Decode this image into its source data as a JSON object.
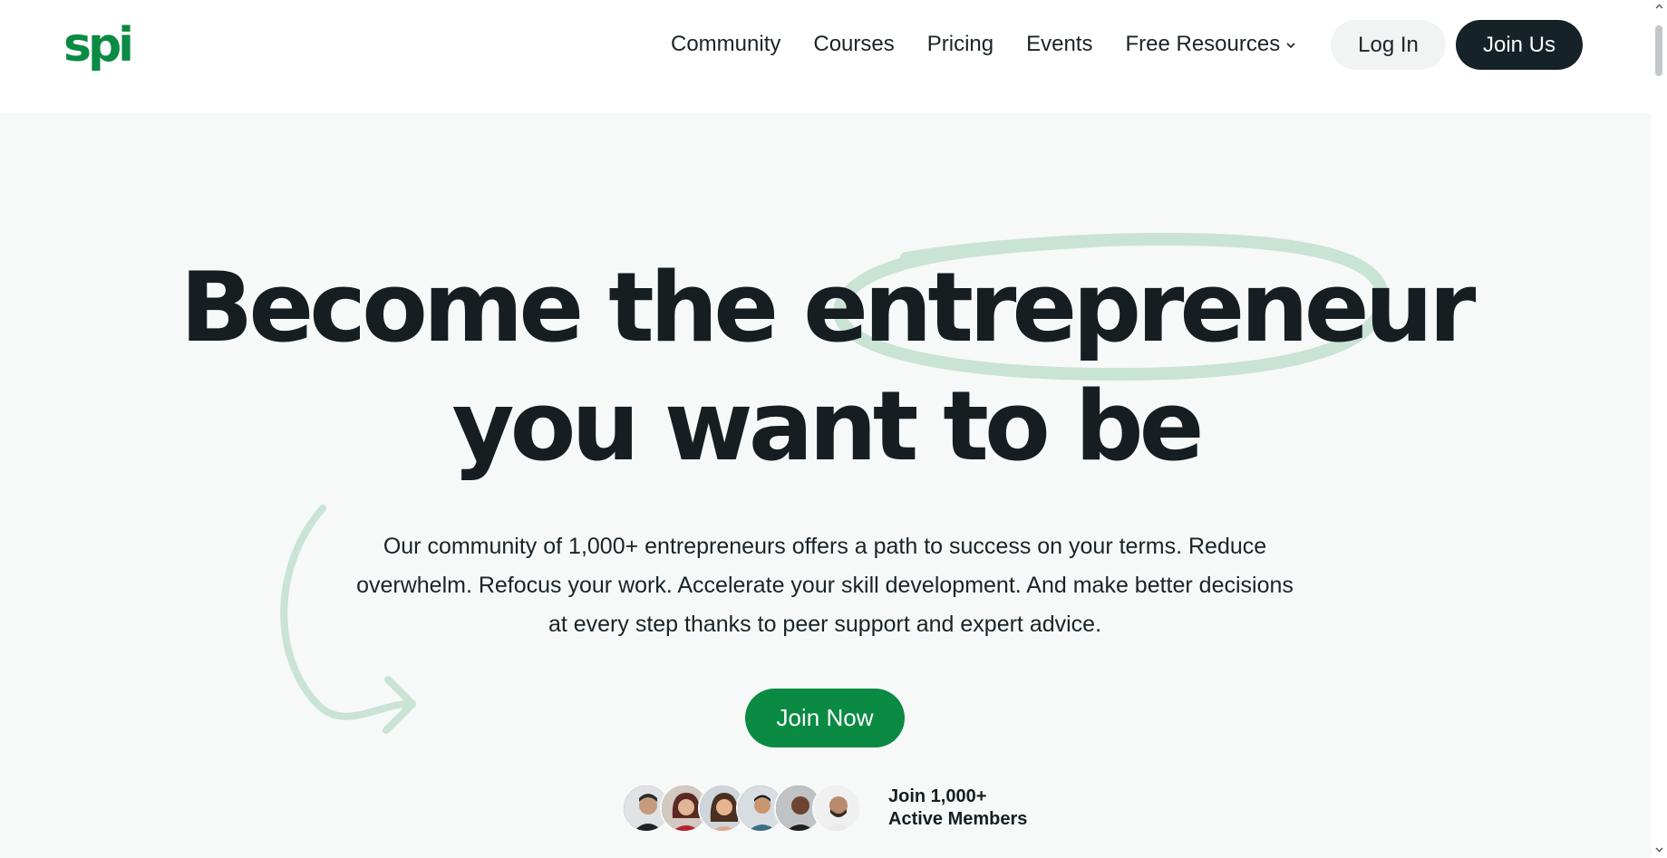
{
  "header": {
    "logo_text": "spi",
    "nav": [
      {
        "label": "Community"
      },
      {
        "label": "Courses"
      },
      {
        "label": "Pricing"
      },
      {
        "label": "Events"
      },
      {
        "label": "Free Resources"
      }
    ],
    "login_label": "Log In",
    "join_label": "Join Us"
  },
  "hero": {
    "headline_line1": "Become the entrepreneur",
    "headline_line2": "you want to be",
    "description": "Our community of 1,000+ entrepreneurs offers a path to success on your terms. Reduce overwhelm. Refocus your work. Accelerate your skill development. And make better decisions at every step thanks to peer support and expert advice.",
    "cta_label": "Join Now",
    "members_line1": "Join 1,000+",
    "members_line2": "Active Members",
    "avatar_count": 6
  },
  "icons": {
    "chevron": "chevron-down-icon",
    "arrow": "curved-arrow-icon",
    "oval": "hand-drawn-oval",
    "scroll_up": "scroll-up-arrow",
    "scroll_down": "scroll-down-arrow"
  },
  "colors": {
    "brand_green": "#0a8a43",
    "dark": "#152227",
    "hero_bg": "#f6f9f8",
    "accent_light_green": "#c9e3d5"
  }
}
